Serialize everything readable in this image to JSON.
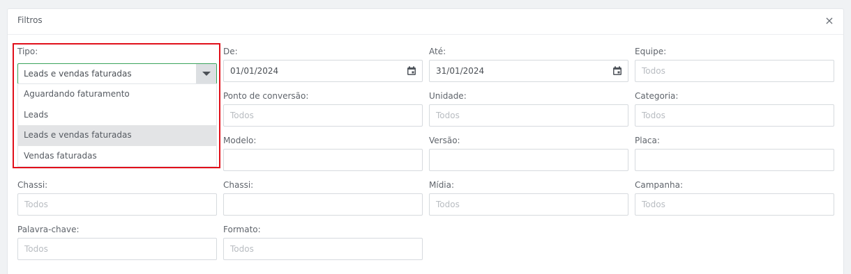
{
  "panel": {
    "title": "Filtros",
    "close_symbol": "×"
  },
  "tipo": {
    "label": "Tipo:",
    "selected": "Leads e vendas faturadas",
    "options": [
      "Aguardando faturamento",
      "Leads",
      "Leads e vendas faturadas",
      "Vendas faturadas"
    ],
    "selected_index": 2
  },
  "fields": {
    "de": {
      "label": "De:",
      "value": "01/01/2024"
    },
    "ate": {
      "label": "Até:",
      "value": "31/01/2024"
    },
    "equipe": {
      "label": "Equipe:",
      "placeholder": "Todos"
    },
    "ponto_conversao": {
      "label": "Ponto de conversão:",
      "placeholder": "Todos"
    },
    "unidade": {
      "label": "Unidade:",
      "placeholder": "Todos"
    },
    "categoria": {
      "label": "Categoria:",
      "placeholder": "Todos"
    },
    "modelo": {
      "label": "Modelo:",
      "placeholder": ""
    },
    "versao": {
      "label": "Versão:",
      "placeholder": ""
    },
    "placa": {
      "label": "Placa:",
      "placeholder": ""
    },
    "chassi_1": {
      "label": "Chassi:",
      "placeholder": "Todos"
    },
    "chassi_2": {
      "label": "Chassi:",
      "placeholder": ""
    },
    "midia": {
      "label": "Mídia:",
      "placeholder": "Todos"
    },
    "campanha": {
      "label": "Campanha:",
      "placeholder": "Todos"
    },
    "palavra_chave": {
      "label": "Palavra-chave:",
      "placeholder": "Todos"
    },
    "formato": {
      "label": "Formato:",
      "placeholder": "Todos"
    }
  },
  "colors": {
    "accent_green": "#3aa35c",
    "highlight_red": "#e10f1a"
  },
  "icons": {
    "calendar": "calendar-icon",
    "close": "close-icon",
    "dropdown": "chevron-down-icon"
  }
}
